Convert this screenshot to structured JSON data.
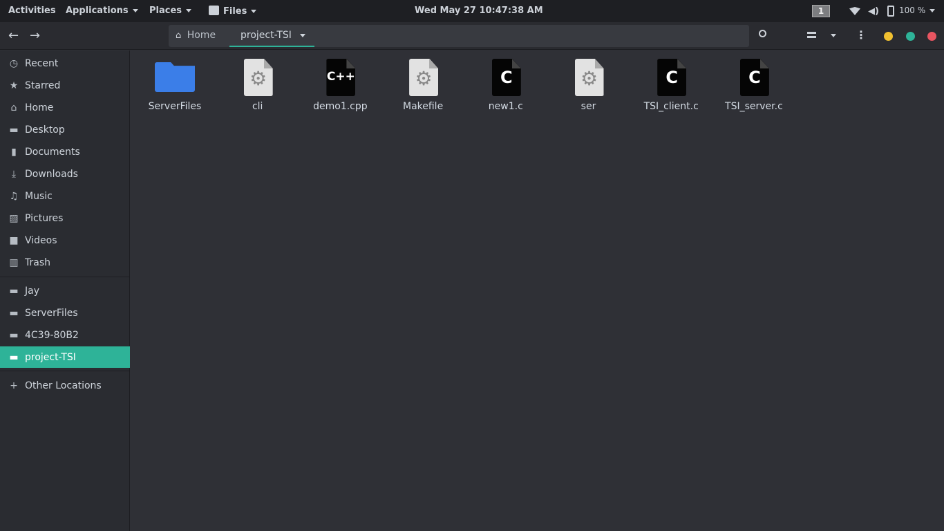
{
  "topbar": {
    "activities": "Activities",
    "applications": "Applications",
    "places": "Places",
    "files": "Files",
    "clock": "Wed May 27  10:47:38 AM",
    "workspace": "1",
    "battery": "100 %"
  },
  "pathbar": {
    "home": "Home",
    "current": "project-TSI"
  },
  "sidebar": {
    "items": [
      {
        "label": "Recent",
        "icon": "clock-icon"
      },
      {
        "label": "Starred",
        "icon": "star-icon"
      },
      {
        "label": "Home",
        "icon": "home-icon"
      },
      {
        "label": "Desktop",
        "icon": "desktop-icon"
      },
      {
        "label": "Documents",
        "icon": "document-icon"
      },
      {
        "label": "Downloads",
        "icon": "download-icon"
      },
      {
        "label": "Music",
        "icon": "music-icon"
      },
      {
        "label": "Pictures",
        "icon": "picture-icon"
      },
      {
        "label": "Videos",
        "icon": "video-icon"
      },
      {
        "label": "Trash",
        "icon": "trash-icon"
      }
    ],
    "bookmarks": [
      {
        "label": "Jay"
      },
      {
        "label": "ServerFiles"
      },
      {
        "label": "4C39-80B2"
      },
      {
        "label": "project-TSI",
        "active": true
      }
    ],
    "other": "Other Locations"
  },
  "files": [
    {
      "name": "ServerFiles",
      "type": "folder"
    },
    {
      "name": "cli",
      "type": "executable"
    },
    {
      "name": "demo1.cpp",
      "type": "cpp",
      "glyph": "C++"
    },
    {
      "name": "Makefile",
      "type": "makefile"
    },
    {
      "name": "new1.c",
      "type": "c",
      "glyph": "C"
    },
    {
      "name": "ser",
      "type": "executable"
    },
    {
      "name": "TSI_client.c",
      "type": "c",
      "glyph": "C"
    },
    {
      "name": "TSI_server.c",
      "type": "c",
      "glyph": "C"
    }
  ],
  "colors": {
    "accent": "#2eb398",
    "minimize": "#f0c030",
    "maximize": "#2eb398",
    "close": "#e85561",
    "folder": "#3b7ee8"
  }
}
